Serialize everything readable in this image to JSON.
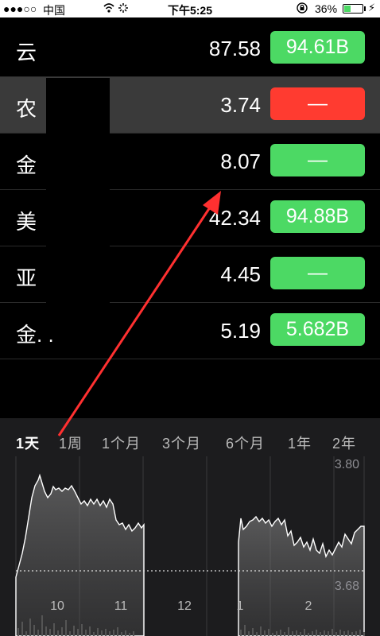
{
  "status_bar": {
    "signal": "●●●○○",
    "carrier": "中国",
    "time": "下午5:25",
    "battery_percent": "36%",
    "battery_level": 0.36
  },
  "stocks": [
    {
      "name": "云",
      "price": "87.58",
      "badge": "94.61B",
      "badge_color": "#4cd964",
      "selected": false
    },
    {
      "name": "农",
      "price": "3.74",
      "badge": "—",
      "badge_color": "#ff3b30",
      "selected": true
    },
    {
      "name": "金",
      "price": "8.07",
      "badge": "—",
      "badge_color": "#4cd964",
      "selected": false
    },
    {
      "name": "美",
      "price": "42.34",
      "badge": "94.88B",
      "badge_color": "#4cd964",
      "selected": false
    },
    {
      "name": "亚",
      "price": "4.45",
      "badge": "—",
      "badge_color": "#4cd964",
      "selected": false
    },
    {
      "name": "金. .",
      "price": "5.19",
      "badge": "5.682B",
      "badge_color": "#4cd964",
      "selected": false
    }
  ],
  "range_tabs": [
    "1天",
    "1周",
    "1个月",
    "3个月",
    "6个月",
    "1年",
    "2年"
  ],
  "active_range": "1天",
  "chart": {
    "y_high_label": "3.80",
    "y_low_label": "3.68",
    "x_labels": [
      "10",
      "11",
      "12",
      "1",
      "2"
    ]
  },
  "colors": {
    "up": "#4cd964",
    "down": "#ff3b30",
    "annotation_arrow": "#ff3030"
  }
}
